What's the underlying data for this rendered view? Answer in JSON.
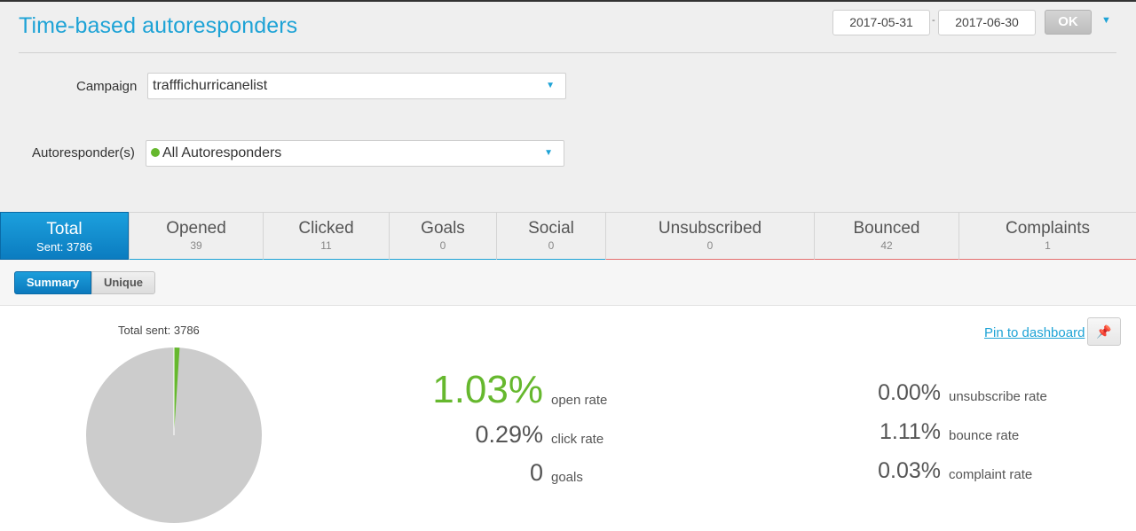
{
  "header": {
    "title": "Time-based autoresponders",
    "date_from": "2017-05-31",
    "date_sep": "-",
    "date_to": "2017-06-30",
    "ok_label": "OK",
    "range_caret": "▼"
  },
  "filters": {
    "campaign_label": "Campaign",
    "campaign_value": "trafffichurricanelist",
    "autoresponder_label": "Autoresponder(s)",
    "autoresponder_value": "All Autoresponders",
    "caret": "▼"
  },
  "tabs": [
    {
      "label": "Total",
      "count": "Sent: 3786"
    },
    {
      "label": "Opened",
      "count": "39"
    },
    {
      "label": "Clicked",
      "count": "11"
    },
    {
      "label": "Goals",
      "count": "0"
    },
    {
      "label": "Social",
      "count": "0"
    },
    {
      "label": "Unsubscribed",
      "count": "0"
    },
    {
      "label": "Bounced",
      "count": "42"
    },
    {
      "label": "Complaints",
      "count": "1"
    }
  ],
  "view_toggle": {
    "summary": "Summary",
    "unique": "Unique"
  },
  "pie": {
    "caption": "Total sent: 3786",
    "opened_fraction": 0.0103,
    "colors": {
      "rest": "#cccccc",
      "opened": "#66b82e"
    }
  },
  "pin": {
    "link": "Pin to dashboard",
    "icon": "pushpin-icon"
  },
  "metrics_left": [
    {
      "value": "1.03%",
      "label": "open rate"
    },
    {
      "value": "0.29%",
      "label": "click rate"
    },
    {
      "value": "0",
      "label": "goals"
    }
  ],
  "metrics_right": [
    {
      "value": "0.00%",
      "label": "unsubscribe rate"
    },
    {
      "value": "1.11%",
      "label": "bounce rate"
    },
    {
      "value": "0.03%",
      "label": "complaint rate"
    }
  ],
  "colors": {
    "accent": "#1ea3d6",
    "green": "#66b82e",
    "red_underline": "#e46f6f"
  }
}
